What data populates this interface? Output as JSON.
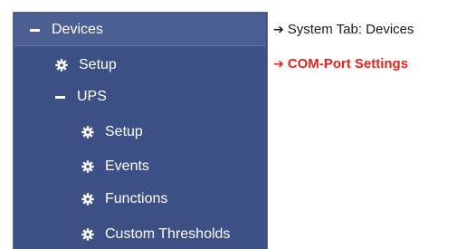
{
  "nav": {
    "devices_label": "Devices",
    "devices_setup_label": "Setup",
    "ups_label": "UPS",
    "ups_setup_label": "Setup",
    "events_label": "Events",
    "functions_label": "Functions",
    "custom_thresholds_label": "Custom Thresholds"
  },
  "annotations": {
    "system_tab": "System Tab: Devices",
    "com_port": "COM-Port Settings"
  },
  "icons": {
    "collapse": "minus-icon",
    "settings": "gear-icon",
    "pointer": "right-arrow-icon"
  },
  "colors": {
    "panel_bg": "#3d5085",
    "header_bg": "#4b5f95",
    "highlight_text": "#e8221c"
  }
}
